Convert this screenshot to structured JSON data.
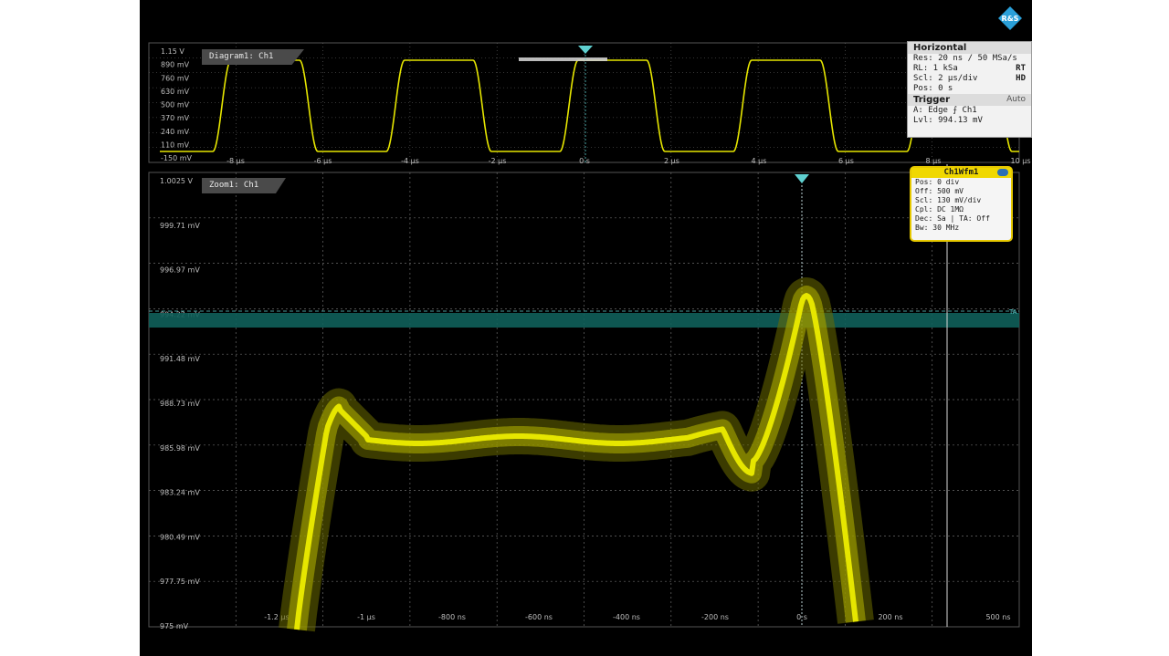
{
  "upper_diagram": {
    "tab": "Diagram1: Ch1",
    "y_labels": [
      "1.15 V",
      "890 mV",
      "760 mV",
      "630 mV",
      "500 mV",
      "370 mV",
      "240 mV",
      "110 mV",
      "-150 mV"
    ],
    "x_labels": [
      "-8 µs",
      "-6 µs",
      "-4 µs",
      "-2 µs",
      "0 s",
      "2 µs",
      "4 µs",
      "6 µs",
      "8 µs",
      "10 µs"
    ]
  },
  "zoom_diagram": {
    "tab": "Zoom1: Ch1",
    "y_labels": [
      "1.0025 V",
      "999.71 mV",
      "996.97 mV",
      "994.22 mV",
      "991.48 mV",
      "988.73 mV",
      "985.98 mV",
      "983.24 mV",
      "980.49 mV",
      "977.75 mV",
      "975 mV"
    ],
    "x_labels": [
      "-1.2 µs",
      "-1 µs",
      "-800 ns",
      "-600 ns",
      "-400 ns",
      "-200 ns",
      "0 s",
      "200 ns",
      "500 ns"
    ],
    "trigger_marker": "TA"
  },
  "horizontal_panel": {
    "title": "Horizontal",
    "res": "Res: 20 ns / 50 MSa/s",
    "rl": "RL: 1 kSa",
    "rl_badge": "RT",
    "scl": "Scl: 2 µs/div",
    "scl_badge": "HD",
    "pos": "Pos: 0 s",
    "trigger_title": "Trigger",
    "trigger_mode": "Auto",
    "edge": "A: Edge ⨍ Ch1",
    "lvl": "Lvl: 994.13 mV"
  },
  "channel_panel": {
    "title": "Ch1Wfm1",
    "pos": "Pos: 0 div",
    "off": "Off: 500 mV",
    "scl": "Scl: 130 mV/div",
    "cpl": "Cpl: DC 1MΩ",
    "dec": "Dec: Sa | TA: Off",
    "bw": "Bw: 30 MHz"
  },
  "colors": {
    "trace": "#e6e600",
    "trigger_level_band": "#0f5f5a",
    "trigger_line": "#5fd0d0",
    "grid": "#6a6a6a",
    "logo": "#2a9fd8"
  },
  "icons": {
    "logo": "rohde-schwarz-logo-icon",
    "channel_toggle": "toggle-icon",
    "trigger_arrow": "trigger-arrow-icon"
  }
}
